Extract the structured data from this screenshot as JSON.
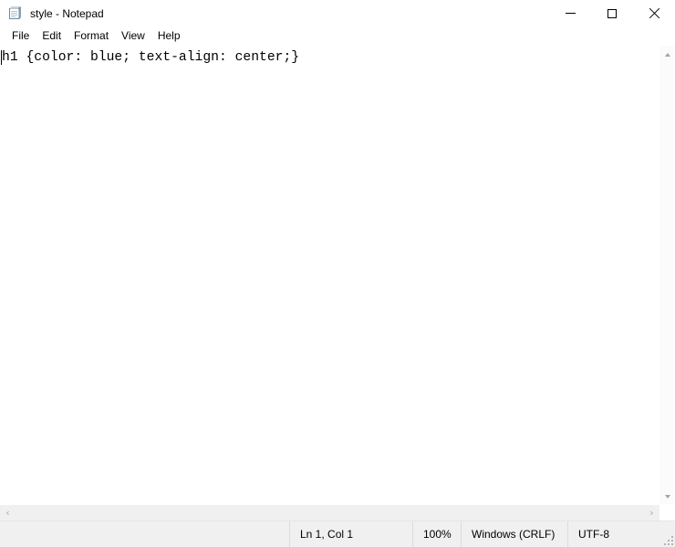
{
  "window": {
    "title": "style - Notepad",
    "app_icon": "notepad-icon",
    "controls": {
      "minimize": "minimize-icon",
      "maximize": "maximize-icon",
      "close": "close-icon"
    }
  },
  "menubar": {
    "items": [
      {
        "label": "File"
      },
      {
        "label": "Edit"
      },
      {
        "label": "Format"
      },
      {
        "label": "View"
      },
      {
        "label": "Help"
      }
    ]
  },
  "editor": {
    "content": "h1 {color: blue; text-align: center;}",
    "caret_line": 1,
    "caret_column": 1
  },
  "scrollbars": {
    "vertical": {
      "up_arrow": "scroll-up-icon",
      "down_arrow": "scroll-down-icon"
    },
    "horizontal": {
      "left_arrow": "scroll-left-icon",
      "right_arrow": "scroll-right-icon",
      "left_glyph": "‹",
      "right_glyph": "›"
    }
  },
  "statusbar": {
    "position": "Ln 1, Col 1",
    "zoom": "100%",
    "line_ending": "Windows (CRLF)",
    "encoding": "UTF-8"
  },
  "colors": {
    "window_bg": "#ffffff",
    "statusbar_bg": "#f0f0f0",
    "scroll_track": "#f0f0f0",
    "arrow_gray": "#a3a3a3",
    "text": "#000000"
  }
}
